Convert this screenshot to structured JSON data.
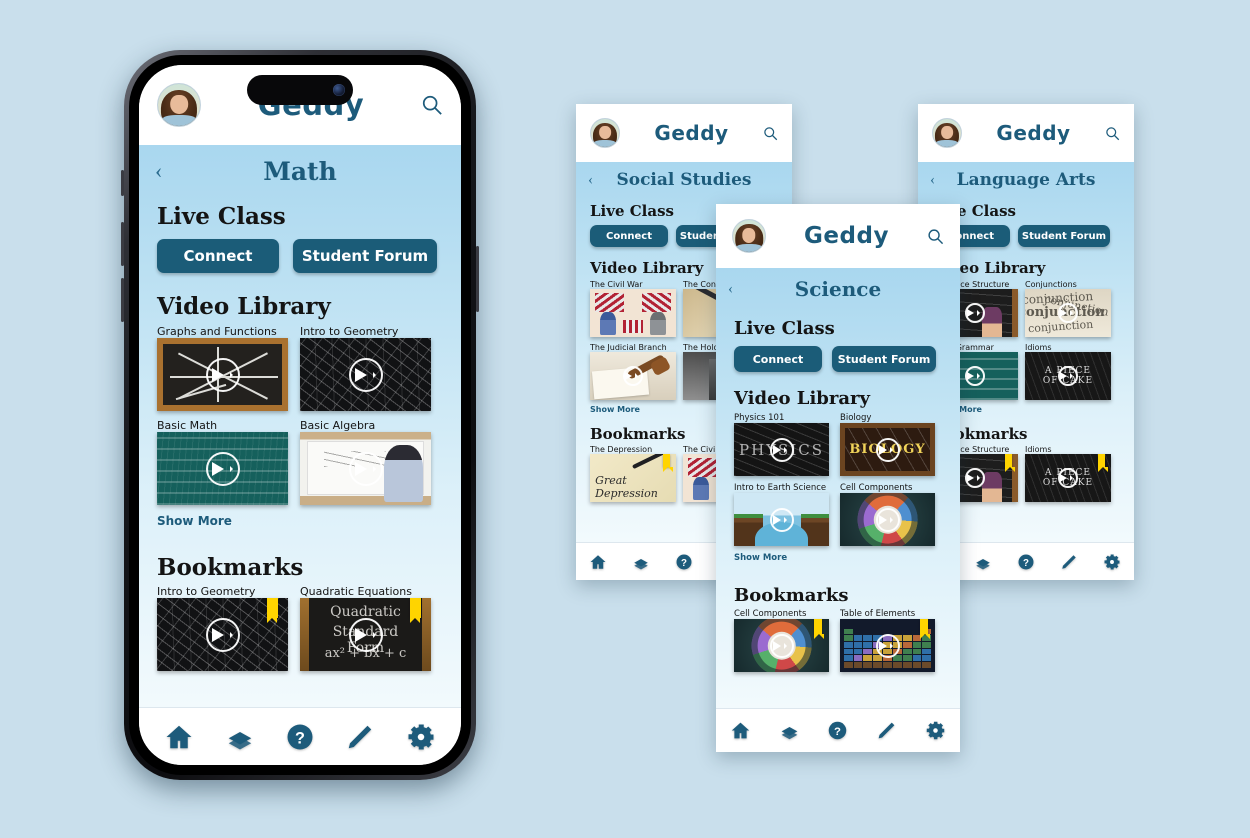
{
  "app": {
    "brand": "Geddy",
    "accent_dark": "#1b5c78",
    "accent_text": "#1d5b7b",
    "page_bg": "#c9dfec",
    "content_gradient_top": "#a9d7ef",
    "content_gradient_bottom": "#f2fafd",
    "bookmark_flag_color": "#ffd400"
  },
  "labels": {
    "live_class": "Live Class",
    "video_library": "Video Library",
    "bookmarks": "Bookmarks",
    "connect": "Connect",
    "student_forum": "Student Forum",
    "show_more": "Show More",
    "back": "‹"
  },
  "icons": {
    "search": "search-icon",
    "home": "home-icon",
    "book": "book-icon",
    "help": "help-icon",
    "pencil": "pencil-icon",
    "gear": "gear-icon",
    "play": "play-icon",
    "avatar": "user-avatar",
    "bookmark_flag": "bookmark-flag-icon"
  },
  "nav_items": [
    {
      "name": "home-icon",
      "label": "Home"
    },
    {
      "name": "book-icon",
      "label": "Library"
    },
    {
      "name": "help-icon",
      "label": "Help"
    },
    {
      "name": "pencil-icon",
      "label": "Notes"
    },
    {
      "name": "gear-icon",
      "label": "Settings"
    }
  ],
  "screens": {
    "math": {
      "subject": "Math",
      "videos": [
        {
          "title": "Graphs and Functions",
          "art": "graph"
        },
        {
          "title": "Intro to Geometry",
          "art": "chalk-dark"
        },
        {
          "title": "Basic Math",
          "art": "green"
        },
        {
          "title": "Basic Algebra",
          "art": "white"
        }
      ],
      "bookmarks": [
        {
          "title": "Intro to Geometry",
          "art": "chalk-dark"
        },
        {
          "title": "Quadratic Equations",
          "art": "quad",
          "art_text": [
            "Quadratic",
            "Standard Form",
            "ax² + bx + c"
          ]
        }
      ]
    },
    "social_studies": {
      "subject": "Social Studies",
      "videos": [
        {
          "title": "The Civil War",
          "art": "flags"
        },
        {
          "title": "The Constitution",
          "art": "constitution"
        },
        {
          "title": "The Judicial Branch",
          "art": "gavel"
        },
        {
          "title": "The Holocaust",
          "art": "holo"
        }
      ],
      "bookmarks": [
        {
          "title": "The Depression",
          "art": "depress",
          "art_text": [
            "Great Depression"
          ]
        },
        {
          "title": "The Civil War",
          "art": "flags"
        }
      ]
    },
    "science": {
      "subject": "Science",
      "videos": [
        {
          "title": "Physics 101",
          "art": "physics",
          "art_text": [
            "PHYSICS"
          ]
        },
        {
          "title": "Biology",
          "art": "bio",
          "art_text": [
            "BIOLOGY"
          ]
        },
        {
          "title": "Intro to Earth Science",
          "art": "earth"
        },
        {
          "title": "Cell Components",
          "art": "cell"
        }
      ],
      "bookmarks": [
        {
          "title": "Cell Components",
          "art": "cell"
        },
        {
          "title": "Table of Elements",
          "art": "periodic"
        }
      ]
    },
    "language_arts": {
      "subject": "Language Arts",
      "videos": [
        {
          "title": "Sentence Structure",
          "art": "sentence"
        },
        {
          "title": "Conjunctions",
          "art": "conj",
          "art_text": [
            "conjunction",
            "conjunction",
            "conjunction",
            "conjunction"
          ]
        },
        {
          "title": "Basic Grammar",
          "art": "greenboard"
        },
        {
          "title": "Idioms",
          "art": "idiom",
          "art_text": [
            "A PIECE",
            "OF CAKE"
          ]
        }
      ],
      "bookmarks": [
        {
          "title": "Sentence Structure",
          "art": "sentence"
        },
        {
          "title": "Idioms",
          "art": "idiom",
          "art_text": [
            "A PIECE",
            "OF CAKE"
          ]
        }
      ]
    }
  }
}
